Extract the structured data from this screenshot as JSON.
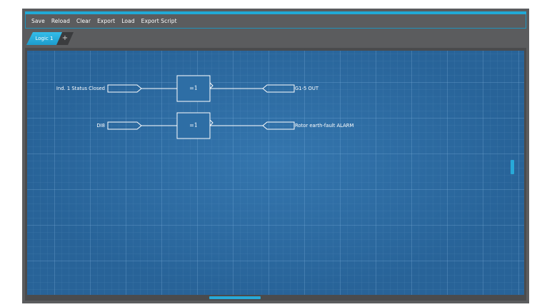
{
  "menu": {
    "items": [
      "Save",
      "Reload",
      "Clear",
      "Export",
      "Load",
      "Export Script"
    ]
  },
  "tabs": {
    "active_label": "Logic 1",
    "add_label": "+"
  },
  "diagram": {
    "rows": [
      {
        "input_label": "Ind. 1 Status Closed",
        "gate_label": "=1",
        "output_label": "G1-5 OUT"
      },
      {
        "input_label": "DI8",
        "gate_label": "=1",
        "output_label": "Rotor earth-fault ALARM"
      }
    ]
  },
  "colors": {
    "accent": "#21a9d6",
    "canvas": "#2b6aa0",
    "frame": "#5b5c5e"
  }
}
